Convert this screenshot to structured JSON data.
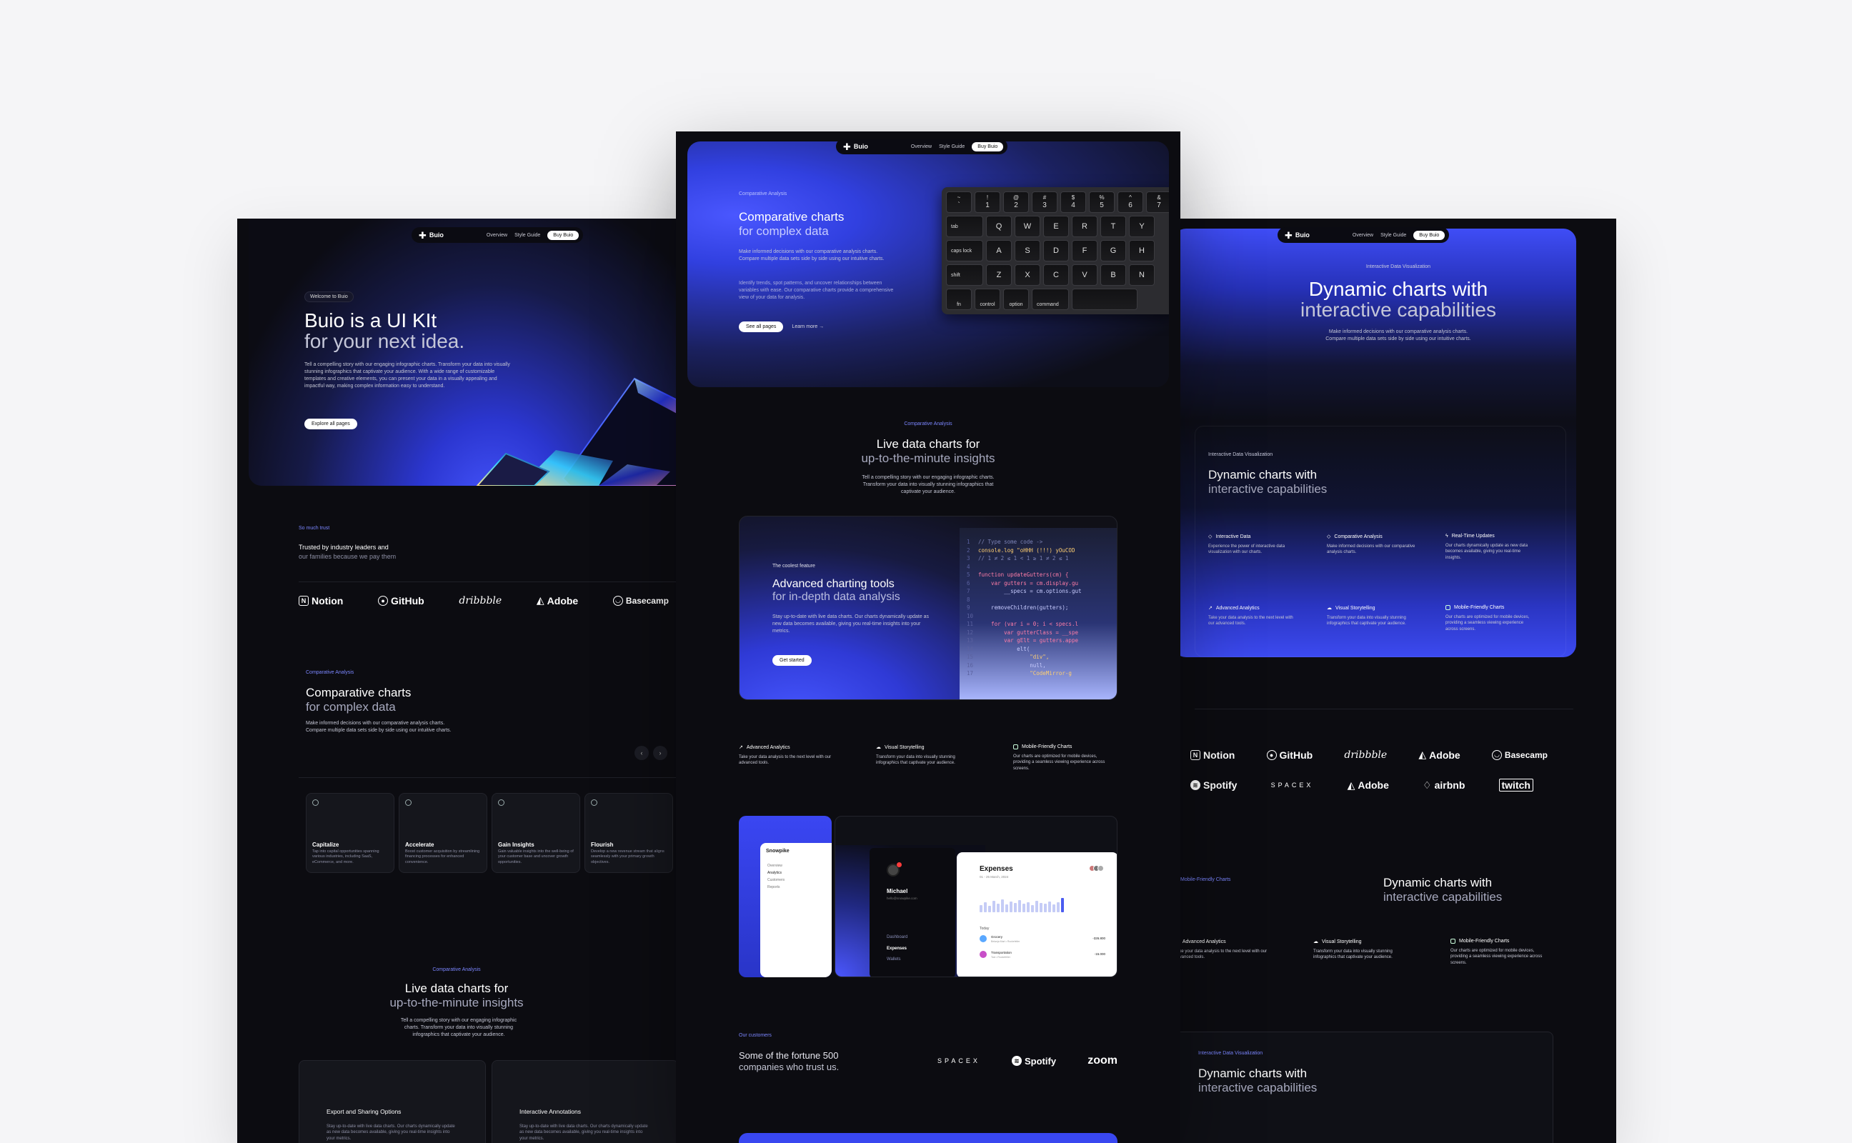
{
  "nav": {
    "brand": "Buio",
    "links": [
      "Overview",
      "Style Guide"
    ],
    "buy": "Buy Buio"
  },
  "left": {
    "hero_eyebrow": "Welcome to Buio",
    "hero_title": "Buio is a UI KIt",
    "hero_subtitle": "for your next idea.",
    "hero_text": "Tell a compelling story with our engaging infographic charts. Transform your data into visually stunning infographics that captivate your audience. With a wide range of customizable templates and creative elements, you can present your data in a visually appealing and impactful way, making complex information easy to understand.",
    "hero_button": "Explore all pages",
    "trust_eyebrow": "So much trust",
    "trust_text_a": "Trusted by industry leaders and",
    "trust_text_b": "our families because we pay them",
    "logos": [
      "Notion",
      "GitHub",
      "dribbble",
      "Adobe",
      "Basecamp"
    ],
    "comp_eyebrow": "Comparative Analysis",
    "comp_title": "Comparative charts",
    "comp_subtitle": "for complex data",
    "comp_text": "Make informed decisions with our comparative analysis charts. Compare multiple data sets side by side using our intuitive charts.",
    "cards": [
      {
        "title": "Capitalize",
        "text": "Tap into capital opportunities spanning various industries, including SaaS, eCommerce, and more."
      },
      {
        "title": "Accelerate",
        "text": "Boost customer acquisition by streamlining financing processes for enhanced convenience."
      },
      {
        "title": "Gain Insights",
        "text": "Gain valuable insights into the well-being of your customer base and uncover growth opportunities."
      },
      {
        "title": "Flourish",
        "text": "Develop a new revenue stream that aligns seamlessly with your primary growth objectives."
      }
    ],
    "live_eyebrow": "Comparative Analysis",
    "live_title": "Live data charts for",
    "live_subtitle": "up-to-the-minute insights",
    "live_text": "Tell a compelling story with our engaging infographic charts. Transform your data into visually stunning infographics that captivate your audience.",
    "bottom_cards": [
      {
        "title": "Export and Sharing Options",
        "text": "Stay up-to-date with live data charts. Our charts dynamically update as new data becomes available, giving you real-time insights into your metrics."
      },
      {
        "title": "Interactive Annotations",
        "text": "Stay up-to-date with live data charts. Our charts dynamically update as new data becomes available, giving you real-time insights into your metrics."
      }
    ]
  },
  "center": {
    "hero_eyebrow": "Comparative Analysis",
    "hero_title": "Comparative charts",
    "hero_subtitle": "for complex data",
    "hero_text": "Make informed decisions with our comparative analysis charts. Compare multiple data sets side by side using our intuitive charts.",
    "hero_text2": "Identify trends, spot patterns, and uncover relationships between variables with ease. Our comparative charts provide a comprehensive view of your data for analysis.",
    "btn_primary": "See all pages",
    "btn_secondary": "Learn more →",
    "keyboard": {
      "row1": [
        [
          "~",
          "`"
        ],
        [
          "!",
          "1"
        ],
        [
          "@",
          "2"
        ],
        [
          "#",
          "3"
        ],
        [
          "$",
          "4"
        ],
        [
          "%",
          "5"
        ],
        [
          "^",
          "6"
        ],
        [
          "&",
          "7"
        ]
      ],
      "row2": [
        "tab",
        "Q",
        "W",
        "E",
        "R",
        "T",
        "Y"
      ],
      "row3": [
        "caps lock",
        "A",
        "S",
        "D",
        "F",
        "G",
        "H"
      ],
      "row4": [
        "shift",
        "Z",
        "X",
        "C",
        "V",
        "B",
        "N"
      ],
      "row5": [
        "fn",
        "control",
        "option",
        "command"
      ]
    },
    "live_eyebrow": "Comparative Analysis",
    "live_title": "Live data charts for",
    "live_subtitle": "up-to-the-minute insights",
    "live_text": "Tell a compelling story with our engaging infographic charts. Transform your data into visually stunning infographics that captivate your audience.",
    "feature_eyebrow": "The coolest feature",
    "feature_title": "Advanced charting tools",
    "feature_subtitle": "for in-depth data analysis",
    "feature_text": "Stay up-to-date with live data charts. Our charts dynamically update as new data becomes available, giving you real-time insights into your metrics.",
    "feature_button": "Get started",
    "code": [
      "// Type some code ->",
      "console.log \"oHHH (!!!) yOuCOD",
      "// 1 ≠ 2 ≤ 1 < 1 ≥ 1 ≠ 2 ≤ 1",
      "",
      "function updateGutters(cm) {",
      "    var gutters = cm.display.gu",
      "        __specs = cm.options.gut",
      "",
      "    removeChildren(gutters);",
      "",
      "    for (var i = 0; i < specs.l",
      "        var gutterClass = __spe",
      "        var gElt = gutters.appe",
      "            elt(",
      "                \"div\",",
      "                null,",
      "                \"CodeMirror-g"
    ],
    "features": [
      {
        "title": "Advanced Analytics",
        "text": "Take your data analysis to the next level with our advanced tools."
      },
      {
        "title": "Visual Storytelling",
        "text": "Transform your data into visually stunning infographics that captivate your audience."
      },
      {
        "title": "Mobile-Friendly Charts",
        "text": "Our charts are optimized for mobile devices, providing a seamless viewing experience across screens."
      }
    ],
    "dash": {
      "app": "Snowpike",
      "menu": [
        "Overview",
        "Analytics",
        "Customers",
        "Reports"
      ],
      "user": "Michael",
      "user_sub": "hello@snowpike.com",
      "side_links": [
        "Dashboard",
        "Expenses",
        "Wallets"
      ],
      "exp_title": "Expenses",
      "exp_date": "01 - 25 March, 2024",
      "today": "Today",
      "rows": [
        {
          "name": "Grocery",
          "sub": "Belanja Mart • Rockefeller",
          "amount": "-326.800"
        },
        {
          "name": "Transportation",
          "sub": "Taxi • Rockefeller",
          "amount": "-15.000"
        }
      ]
    },
    "customers_eyebrow": "Our customers",
    "customers_text_a": "Some of the fortune 500",
    "customers_text_b": "companies who trust us.",
    "customer_logos": [
      "SPACEX",
      "Spotify",
      "zoom"
    ]
  },
  "right": {
    "hero_eyebrow": "Interactive Data Visualization",
    "hero_title": "Dynamic charts with",
    "hero_subtitle": "interactive capabilities",
    "hero_text": "Make informed decisions with our comparative analysis charts. Compare multiple data sets side by side using our intuitive charts.",
    "panel_eyebrow": "Interactive Data Visualization",
    "panel_title": "Dynamic charts with",
    "panel_subtitle": "interactive capabilities",
    "panel_features": [
      {
        "title": "Interactive Data",
        "text": "Experience the power of interactive data visualization with our charts."
      },
      {
        "title": "Comparative Analysis",
        "text": "Make informed decisions with our comparative analysis charts."
      },
      {
        "title": "Real-Time Updates",
        "text": "Our charts dynamically update as new data becomes available, giving you real-time insights."
      },
      {
        "title": "Advanced Analytics",
        "text": "Take your data analysis to the next level with our advanced tools."
      },
      {
        "title": "Visual Storytelling",
        "text": "Transform your data into visually stunning infographics that captivate your audience."
      },
      {
        "title": "Mobile-Friendly Charts",
        "text": "Our charts are optimized for mobile devices, providing a seamless viewing experience across screens."
      }
    ],
    "logos_row1": [
      "Notion",
      "GitHub",
      "dribbble",
      "Adobe",
      "Basecamp"
    ],
    "logos_row2": [
      "Spotify",
      "SPACEX",
      "Adobe",
      "airbnb",
      "twitch"
    ],
    "mobile_eyebrow": "Mobile-Friendly Charts",
    "mobile_title": "Dynamic charts with",
    "mobile_subtitle": "interactive capabilities",
    "features2": [
      {
        "title": "Advanced Analytics",
        "text": "Take your data analysis to the next level with our advanced tools."
      },
      {
        "title": "Visual Storytelling",
        "text": "Transform your data into visually stunning infographics that captivate your audience."
      },
      {
        "title": "Mobile-Friendly Charts",
        "text": "Our charts are optimized for mobile devices, providing a seamless viewing experience across screens."
      }
    ],
    "bottom_eyebrow": "Interactive Data Visualization",
    "bottom_title": "Dynamic charts with",
    "bottom_subtitle": "interactive capabilities"
  },
  "colors": {
    "accent": "#3a47ff",
    "bg": "#0c0c11",
    "page": "#f5f5f7"
  }
}
